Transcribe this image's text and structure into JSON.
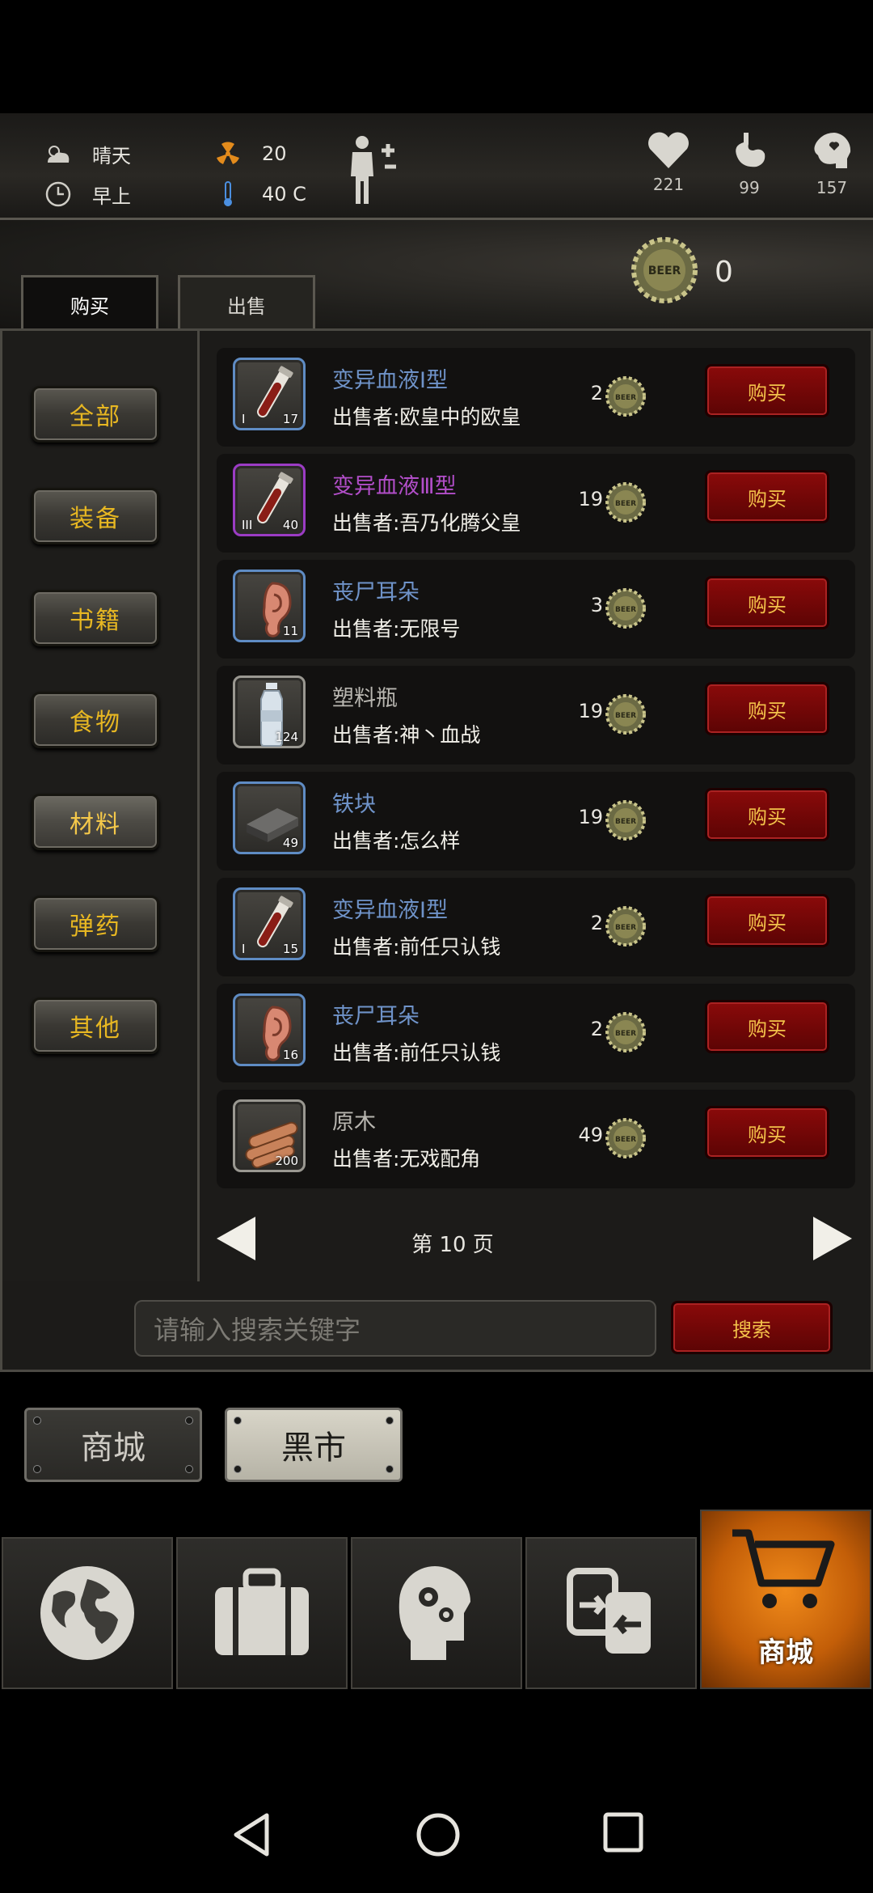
{
  "status": {
    "weather": "晴天",
    "time_of_day": "早上",
    "radiation": "20",
    "temperature": "40 C",
    "health": "221",
    "hunger": "99",
    "mood": "157"
  },
  "shop": {
    "coins": "0",
    "tabs": {
      "buy": "购买",
      "sell": "出售"
    },
    "categories": [
      "全部",
      "装备",
      "书籍",
      "食物",
      "材料",
      "弹药",
      "其他"
    ],
    "selected_category": "材料",
    "buy_label": "购买",
    "items": [
      {
        "name": "变异血液Ⅰ型",
        "seller": "出售者:欧皇中的欧皇",
        "price": "2",
        "qty": "17",
        "icon": "blood-vial-icon",
        "tier": "I",
        "rarity": "blue"
      },
      {
        "name": "变异血液Ⅲ型",
        "seller": "出售者:吾乃化腾父皇",
        "price": "19",
        "qty": "40",
        "icon": "blood-vial-icon",
        "tier": "III",
        "rarity": "purple"
      },
      {
        "name": "丧尸耳朵",
        "seller": "出售者:无限号",
        "price": "3",
        "qty": "11",
        "icon": "ear-icon",
        "tier": "",
        "rarity": "blue"
      },
      {
        "name": "塑料瓶",
        "seller": "出售者:神丶血战",
        "price": "19",
        "qty": "124",
        "icon": "plastic-bottle-icon",
        "tier": "",
        "rarity": "plain"
      },
      {
        "name": "铁块",
        "seller": "出售者:怎么样",
        "price": "19",
        "qty": "49",
        "icon": "iron-ingot-icon",
        "tier": "",
        "rarity": "blue"
      },
      {
        "name": "变异血液Ⅰ型",
        "seller": "出售者:前任只认钱",
        "price": "2",
        "qty": "15",
        "icon": "blood-vial-icon",
        "tier": "I",
        "rarity": "blue"
      },
      {
        "name": "丧尸耳朵",
        "seller": "出售者:前任只认钱",
        "price": "2",
        "qty": "16",
        "icon": "ear-icon",
        "tier": "",
        "rarity": "blue"
      },
      {
        "name": "原木",
        "seller": "出售者:无戏配角",
        "price": "49",
        "qty": "200",
        "icon": "logs-icon",
        "tier": "",
        "rarity": "plain"
      }
    ],
    "page_label": "第 10 页",
    "search_placeholder": "请输入搜索关键字",
    "search_label": "搜索"
  },
  "store_tabs": {
    "shop": "商城",
    "black_market": "黑市"
  },
  "bottom_nav": [
    {
      "icon": "world-map-icon",
      "label": ""
    },
    {
      "icon": "backpack-icon",
      "label": ""
    },
    {
      "icon": "skills-head-icon",
      "label": ""
    },
    {
      "icon": "trade-exchange-icon",
      "label": ""
    },
    {
      "icon": "cart-icon",
      "label": "商城",
      "active": true
    }
  ],
  "colors": {
    "accent_orange": "#e07a10",
    "buy_red": "#7a0707",
    "gold_text": "#e7b722",
    "blue_item": "#6f93c9",
    "purple_item": "#b24ec9"
  }
}
